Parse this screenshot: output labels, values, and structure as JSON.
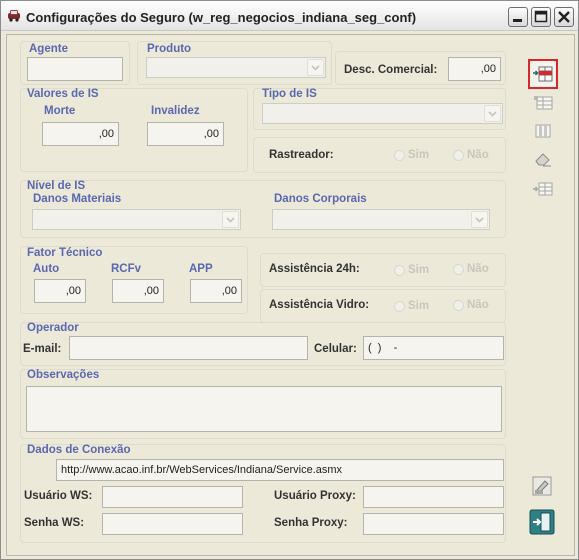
{
  "window": {
    "title": "Configurações do Seguro (w_reg_negocios_indiana_seg_conf)"
  },
  "agente": {
    "label": "Agente",
    "value": ""
  },
  "produto": {
    "label": "Produto",
    "value": ""
  },
  "desc_comercial": {
    "label": "Desc. Comercial:",
    "value": ",00"
  },
  "valores_is": {
    "label": "Valores de IS",
    "morte": {
      "label": "Morte",
      "value": ",00"
    },
    "invalidez": {
      "label": "Invalidez",
      "value": ",00"
    }
  },
  "tipo_is": {
    "label": "Tipo de IS",
    "value": ""
  },
  "rastreador": {
    "label": "Rastreador:",
    "options": [
      "Sim",
      "Não"
    ]
  },
  "nivel_is": {
    "label": "Nível de IS",
    "danos_materiais": {
      "label": "Danos Materiais",
      "value": ""
    },
    "danos_corporais": {
      "label": "Danos Corporais",
      "value": ""
    }
  },
  "fator_tecnico": {
    "label": "Fator Técnico",
    "auto": {
      "label": "Auto",
      "value": ",00"
    },
    "rcfv": {
      "label": "RCFv",
      "value": ",00"
    },
    "app": {
      "label": "APP",
      "value": ",00"
    }
  },
  "assistencia_24h": {
    "label": "Assistência 24h:",
    "options": [
      "Sim",
      "Não"
    ]
  },
  "assistencia_vidro": {
    "label": "Assistência Vidro:",
    "options": [
      "Sim",
      "Não"
    ]
  },
  "operador": {
    "label": "Operador",
    "email_label": "E-mail:",
    "email_value": "",
    "celular_label": "Celular:",
    "celular_value": "(  )    -"
  },
  "observacoes": {
    "label": "Observações",
    "value": ""
  },
  "conexao": {
    "label": "Dados de Conexão",
    "url": "http://www.acao.inf.br/WebServices/Indiana/Service.asmx",
    "usuario_ws_label": "Usuário WS:",
    "usuario_ws_value": "",
    "senha_ws_label": "Senha WS:",
    "senha_ws_value": "",
    "usuario_proxy_label": "Usuário Proxy:",
    "usuario_proxy_value": "",
    "senha_proxy_label": "Senha Proxy:",
    "senha_proxy_value": ""
  },
  "colors": {
    "label_blue": "#5968b1",
    "highlight_red": "#d9262a",
    "icon_green": "#1f6b6b"
  },
  "icons": [
    "insert-row-icon",
    "table-grid-icon",
    "columns-icon",
    "eraser-icon",
    "insert-table-icon",
    "print-disabled-icon",
    "exit-door-icon"
  ]
}
